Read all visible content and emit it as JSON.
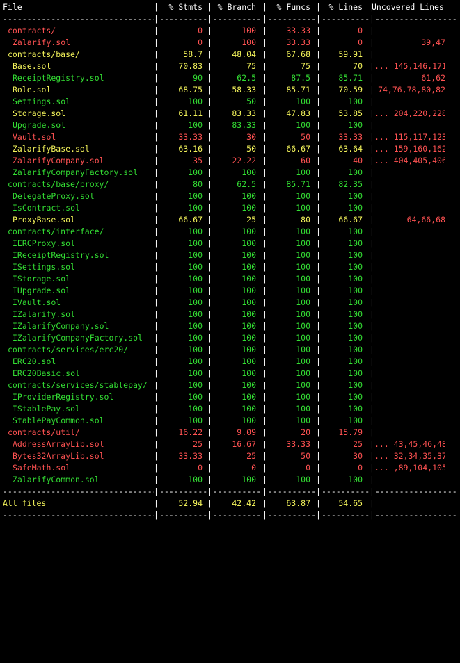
{
  "colors": {
    "background": "#000000",
    "high": "#33dd33",
    "medium": "#f2f25a",
    "low": "#ff5252",
    "text": "#ffffff"
  },
  "header": {
    "file": "File",
    "stmts": "% Stmts",
    "branch": "% Branch",
    "funcs": "% Funcs",
    "lines": "% Lines",
    "uncovered": "Uncovered Lines"
  },
  "separator": "--------------------------------------------------------------------------------------------------------",
  "rows": [
    {
      "file": "contracts/",
      "indent": 0,
      "stmts": "0",
      "branch": "100",
      "funcs": "33.33",
      "lines": "0",
      "uncovered": "",
      "color": "red"
    },
    {
      "file": "Zalarify.sol",
      "indent": 1,
      "stmts": "0",
      "branch": "100",
      "funcs": "33.33",
      "lines": "0",
      "uncovered": "39,47",
      "color": "red"
    },
    {
      "file": "contracts/base/",
      "indent": 0,
      "stmts": "58.7",
      "branch": "48.04",
      "funcs": "67.68",
      "lines": "59.91",
      "uncovered": "",
      "color": "yellow"
    },
    {
      "file": "Base.sol",
      "indent": 1,
      "stmts": "70.83",
      "branch": "75",
      "funcs": "75",
      "lines": "70",
      "uncovered": "... 145,146,171",
      "color": "yellow"
    },
    {
      "file": "ReceiptRegistry.sol",
      "indent": 1,
      "stmts": "90",
      "branch": "62.5",
      "funcs": "87.5",
      "lines": "85.71",
      "uncovered": "61,62",
      "color": "green"
    },
    {
      "file": "Role.sol",
      "indent": 1,
      "stmts": "68.75",
      "branch": "58.33",
      "funcs": "85.71",
      "lines": "70.59",
      "uncovered": "74,76,78,80,82",
      "color": "yellow"
    },
    {
      "file": "Settings.sol",
      "indent": 1,
      "stmts": "100",
      "branch": "50",
      "funcs": "100",
      "lines": "100",
      "uncovered": "",
      "color": "green"
    },
    {
      "file": "Storage.sol",
      "indent": 1,
      "stmts": "61.11",
      "branch": "83.33",
      "funcs": "47.83",
      "lines": "53.85",
      "uncovered": "... 204,220,228",
      "color": "yellow"
    },
    {
      "file": "Upgrade.sol",
      "indent": 1,
      "stmts": "100",
      "branch": "83.33",
      "funcs": "100",
      "lines": "100",
      "uncovered": "",
      "color": "green"
    },
    {
      "file": "Vault.sol",
      "indent": 1,
      "stmts": "33.33",
      "branch": "30",
      "funcs": "50",
      "lines": "33.33",
      "uncovered": "... 115,117,123",
      "color": "red"
    },
    {
      "file": "ZalarifyBase.sol",
      "indent": 1,
      "stmts": "63.16",
      "branch": "50",
      "funcs": "66.67",
      "lines": "63.64",
      "uncovered": "... 159,160,162",
      "color": "yellow"
    },
    {
      "file": "ZalarifyCompany.sol",
      "indent": 1,
      "stmts": "35",
      "branch": "22.22",
      "funcs": "60",
      "lines": "40",
      "uncovered": "... 404,405,406",
      "color": "red"
    },
    {
      "file": "ZalarifyCompanyFactory.sol",
      "indent": 1,
      "stmts": "100",
      "branch": "100",
      "funcs": "100",
      "lines": "100",
      "uncovered": "",
      "color": "green"
    },
    {
      "file": "contracts/base/proxy/",
      "indent": 0,
      "stmts": "80",
      "branch": "62.5",
      "funcs": "85.71",
      "lines": "82.35",
      "uncovered": "",
      "color": "green"
    },
    {
      "file": "DelegateProxy.sol",
      "indent": 1,
      "stmts": "100",
      "branch": "100",
      "funcs": "100",
      "lines": "100",
      "uncovered": "",
      "color": "green"
    },
    {
      "file": "IsContract.sol",
      "indent": 1,
      "stmts": "100",
      "branch": "100",
      "funcs": "100",
      "lines": "100",
      "uncovered": "",
      "color": "green"
    },
    {
      "file": "ProxyBase.sol",
      "indent": 1,
      "stmts": "66.67",
      "branch": "25",
      "funcs": "80",
      "lines": "66.67",
      "uncovered": "64,66,68",
      "color": "yellow"
    },
    {
      "file": "contracts/interface/",
      "indent": 0,
      "stmts": "100",
      "branch": "100",
      "funcs": "100",
      "lines": "100",
      "uncovered": "",
      "color": "green"
    },
    {
      "file": "IERCProxy.sol",
      "indent": 1,
      "stmts": "100",
      "branch": "100",
      "funcs": "100",
      "lines": "100",
      "uncovered": "",
      "color": "green"
    },
    {
      "file": "IReceiptRegistry.sol",
      "indent": 1,
      "stmts": "100",
      "branch": "100",
      "funcs": "100",
      "lines": "100",
      "uncovered": "",
      "color": "green"
    },
    {
      "file": "ISettings.sol",
      "indent": 1,
      "stmts": "100",
      "branch": "100",
      "funcs": "100",
      "lines": "100",
      "uncovered": "",
      "color": "green"
    },
    {
      "file": "IStorage.sol",
      "indent": 1,
      "stmts": "100",
      "branch": "100",
      "funcs": "100",
      "lines": "100",
      "uncovered": "",
      "color": "green"
    },
    {
      "file": "IUpgrade.sol",
      "indent": 1,
      "stmts": "100",
      "branch": "100",
      "funcs": "100",
      "lines": "100",
      "uncovered": "",
      "color": "green"
    },
    {
      "file": "IVault.sol",
      "indent": 1,
      "stmts": "100",
      "branch": "100",
      "funcs": "100",
      "lines": "100",
      "uncovered": "",
      "color": "green"
    },
    {
      "file": "IZalarify.sol",
      "indent": 1,
      "stmts": "100",
      "branch": "100",
      "funcs": "100",
      "lines": "100",
      "uncovered": "",
      "color": "green"
    },
    {
      "file": "IZalarifyCompany.sol",
      "indent": 1,
      "stmts": "100",
      "branch": "100",
      "funcs": "100",
      "lines": "100",
      "uncovered": "",
      "color": "green"
    },
    {
      "file": "IZalarifyCompanyFactory.sol",
      "indent": 1,
      "stmts": "100",
      "branch": "100",
      "funcs": "100",
      "lines": "100",
      "uncovered": "",
      "color": "green"
    },
    {
      "file": "contracts/services/erc20/",
      "indent": 0,
      "stmts": "100",
      "branch": "100",
      "funcs": "100",
      "lines": "100",
      "uncovered": "",
      "color": "green"
    },
    {
      "file": "ERC20.sol",
      "indent": 1,
      "stmts": "100",
      "branch": "100",
      "funcs": "100",
      "lines": "100",
      "uncovered": "",
      "color": "green"
    },
    {
      "file": "ERC20Basic.sol",
      "indent": 1,
      "stmts": "100",
      "branch": "100",
      "funcs": "100",
      "lines": "100",
      "uncovered": "",
      "color": "green"
    },
    {
      "file": "contracts/services/stablepay/",
      "indent": 0,
      "stmts": "100",
      "branch": "100",
      "funcs": "100",
      "lines": "100",
      "uncovered": "",
      "color": "green"
    },
    {
      "file": "IProviderRegistry.sol",
      "indent": 1,
      "stmts": "100",
      "branch": "100",
      "funcs": "100",
      "lines": "100",
      "uncovered": "",
      "color": "green"
    },
    {
      "file": "IStablePay.sol",
      "indent": 1,
      "stmts": "100",
      "branch": "100",
      "funcs": "100",
      "lines": "100",
      "uncovered": "",
      "color": "green"
    },
    {
      "file": "StablePayCommon.sol",
      "indent": 1,
      "stmts": "100",
      "branch": "100",
      "funcs": "100",
      "lines": "100",
      "uncovered": "",
      "color": "green"
    },
    {
      "file": "contracts/util/",
      "indent": 0,
      "stmts": "16.22",
      "branch": "9.09",
      "funcs": "20",
      "lines": "15.79",
      "uncovered": "",
      "color": "red"
    },
    {
      "file": "AddressArrayLib.sol",
      "indent": 1,
      "stmts": "25",
      "branch": "16.67",
      "funcs": "33.33",
      "lines": "25",
      "uncovered": "... 43,45,46,48",
      "color": "red"
    },
    {
      "file": "Bytes32ArrayLib.sol",
      "indent": 1,
      "stmts": "33.33",
      "branch": "25",
      "funcs": "50",
      "lines": "30",
      "uncovered": "... 32,34,35,37",
      "color": "red"
    },
    {
      "file": "SafeMath.sol",
      "indent": 1,
      "stmts": "0",
      "branch": "0",
      "funcs": "0",
      "lines": "0",
      "uncovered": "... ,89,104,105",
      "color": "red"
    },
    {
      "file": "ZalarifyCommon.sol",
      "indent": 1,
      "stmts": "100",
      "branch": "100",
      "funcs": "100",
      "lines": "100",
      "uncovered": "",
      "color": "green"
    }
  ],
  "total": {
    "file": "All files",
    "stmts": "52.94",
    "branch": "42.42",
    "funcs": "63.87",
    "lines": "54.65",
    "uncovered": "",
    "color": "yellow"
  }
}
